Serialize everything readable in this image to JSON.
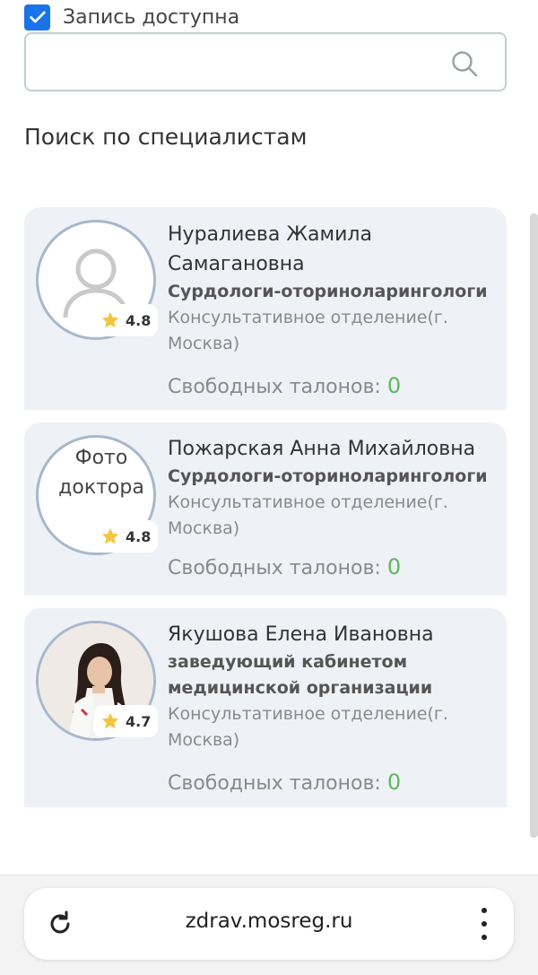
{
  "filter": {
    "available_label": "Запись доступна",
    "available_checked": true
  },
  "search": {
    "value": "",
    "icon": "search-icon"
  },
  "section_title": "Поиск по специалистам",
  "doctors": [
    {
      "name": "Нуралиева Жамила Самагановна",
      "specialty": "Сурдологи-оториноларингологи",
      "department": "Консультативное отделение(г. Москва)",
      "rating": "4.8",
      "tickets_label": "Свободных талонов:",
      "tickets_count": "0",
      "photo": "placeholder-person"
    },
    {
      "name": "Пожарская Анна Михайловна",
      "specialty": "Сурдологи-оториноларингологи",
      "department": "Консультативное отделение(г. Москва)",
      "rating": "4.8",
      "tickets_label": "Свободных талонов:",
      "tickets_count": "0",
      "photo_alt": "Фото доктора"
    },
    {
      "name": "Якушова Елена Ивановна",
      "specialty": "заведующий кабинетом медицинской организации",
      "department": "Консультативное отделение(г. Москва)",
      "rating": "4.7",
      "tickets_label": "Свободных талонов:",
      "tickets_count": "0",
      "photo": "portrait-woman"
    }
  ],
  "browser": {
    "url": "zdrav.mosreg.ru"
  },
  "colors": {
    "accent": "#1a73e8",
    "card_bg": "#eef1f6",
    "tickets_count": "#5cb85c"
  }
}
